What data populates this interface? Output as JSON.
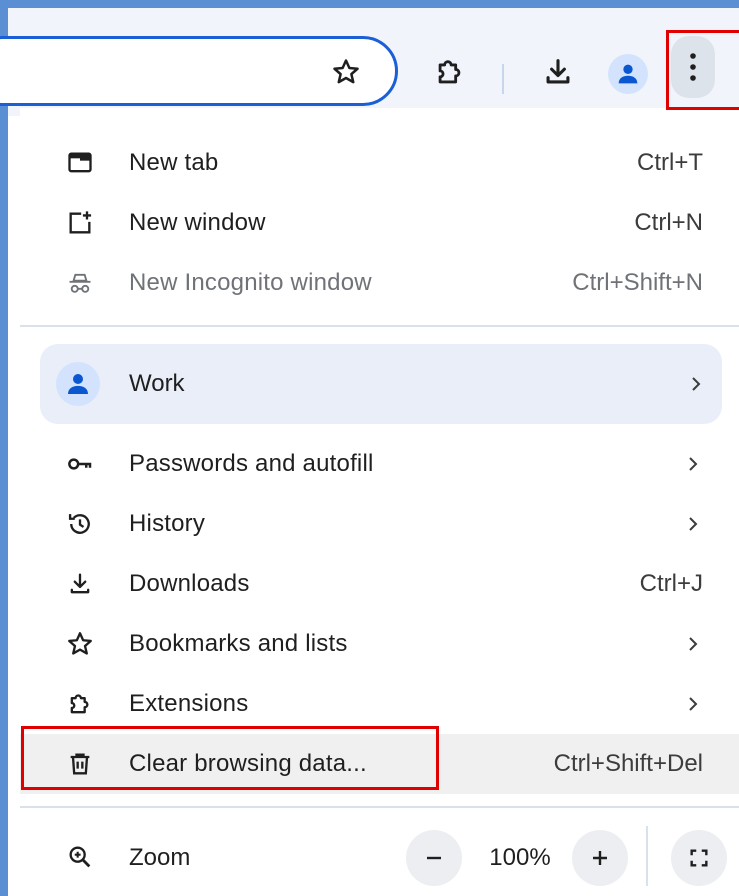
{
  "toolbar": {
    "icons": [
      "star-icon",
      "extensions-icon",
      "download-icon",
      "profile-icon",
      "more-vert-icon"
    ]
  },
  "menu": {
    "items_top": [
      {
        "label": "New tab",
        "shortcut": "Ctrl+T",
        "icon": "new-tab-icon"
      },
      {
        "label": "New window",
        "shortcut": "Ctrl+N",
        "icon": "new-window-icon"
      },
      {
        "label": "New Incognito window",
        "shortcut": "Ctrl+Shift+N",
        "icon": "incognito-icon"
      }
    ],
    "profile": {
      "label": "Work",
      "icon": "profile-icon"
    },
    "items_mid": [
      {
        "label": "Passwords and autofill",
        "icon": "key-icon"
      },
      {
        "label": "History",
        "icon": "history-icon"
      },
      {
        "label": "Downloads",
        "shortcut": "Ctrl+J",
        "icon": "download-icon"
      },
      {
        "label": "Bookmarks and lists",
        "icon": "star-icon"
      },
      {
        "label": "Extensions",
        "icon": "extensions-icon"
      },
      {
        "label": "Clear browsing data...",
        "shortcut": "Ctrl+Shift+Del",
        "icon": "trash-icon"
      }
    ],
    "zoom": {
      "label": "Zoom",
      "value": "100%",
      "minus": "−",
      "plus": "+"
    }
  },
  "colors": {
    "accent": "#1a5fd6",
    "highlight": "#e00000",
    "profile_card": "#e9eef8"
  }
}
